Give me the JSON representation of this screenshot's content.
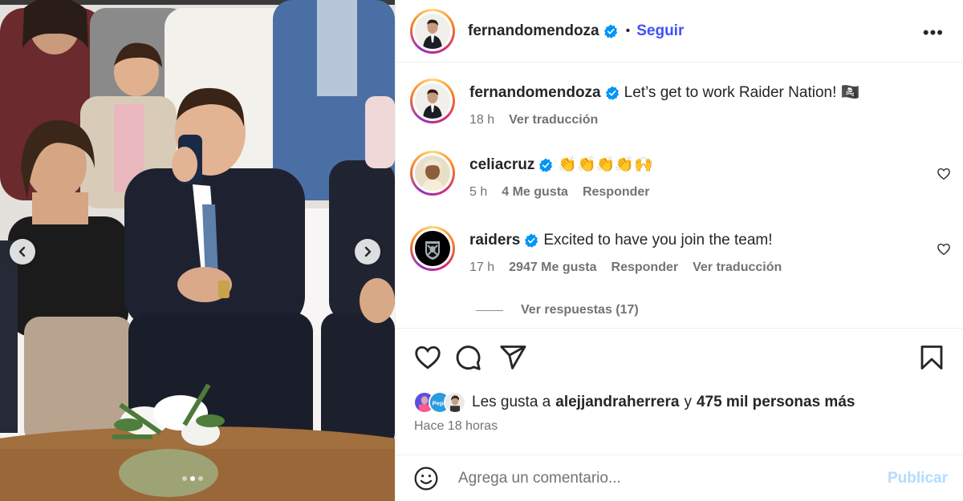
{
  "post": {
    "username": "fernandomendoza",
    "follow_label": "Seguir",
    "bullet": "•",
    "more_label": "•••"
  },
  "comments": [
    {
      "username": "fernandomendoza",
      "text": "Let’s get to work Raider Nation! 🏴‍☠️",
      "time": "18 h",
      "translate": "Ver traducción"
    },
    {
      "username": "celiacruz",
      "text": "👏👏👏👏🙌",
      "time": "5 h",
      "likes": "4 Me gusta",
      "reply": "Responder"
    },
    {
      "username": "raiders",
      "text": "Excited to have you join the team!",
      "time": "17 h",
      "likes": "2947 Me gusta",
      "reply": "Responder",
      "translate": "Ver traducción",
      "view_replies": "Ver respuestas (17)"
    }
  ],
  "likes": {
    "prefix": "Les gusta a",
    "user": "alejjandraherrera",
    "connector": "y",
    "others": "475 mil personas más"
  },
  "time_ago": "Hace 18 horas",
  "composer": {
    "placeholder": "Agrega un comentario...",
    "publish_label": "Publicar"
  },
  "carousel": {
    "slides": 3,
    "active_index": 1
  },
  "icons": {
    "verified": "verified-badge-icon",
    "like": "heart-icon",
    "comment": "comment-bubble-icon",
    "share": "paper-plane-icon",
    "save": "bookmark-icon",
    "emoji": "smiley-face-icon",
    "more": "more-options-icon",
    "prev": "chevron-left-icon",
    "next": "chevron-right-icon"
  },
  "colors": {
    "follow": "#4150f7",
    "verified": "#0095f6",
    "publish_disabled": "#b3dbff",
    "muted": "#737373"
  }
}
